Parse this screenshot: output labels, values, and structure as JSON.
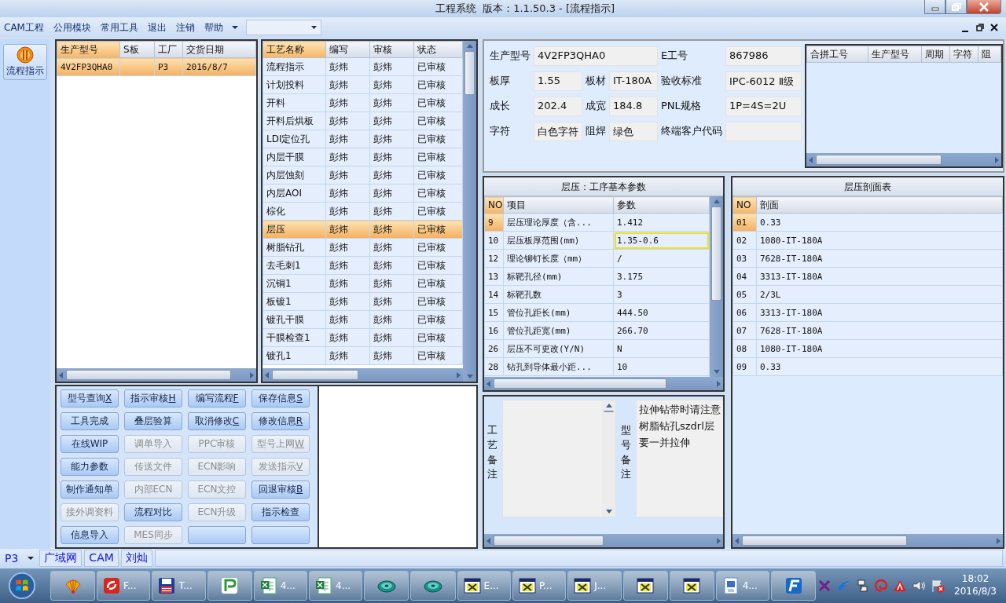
{
  "window": {
    "title": "工程系统  版本：1.1.50.3 - [流程指示]"
  },
  "menu": {
    "items": [
      "CAM工程",
      "公用模块",
      "常用工具",
      "退出",
      "注销",
      "帮助"
    ]
  },
  "sidebar": {
    "items": [
      {
        "label": "流程指示"
      }
    ]
  },
  "orders": {
    "columns": [
      {
        "label": "生产型号",
        "active": true
      },
      {
        "label": "S板",
        "active": false
      },
      {
        "label": "工厂",
        "active": false
      },
      {
        "label": "交货日期",
        "active": false
      }
    ],
    "rows": [
      {
        "model": "4V2FP3QHA0",
        "plant": "P3",
        "delivery": "2016/8/7",
        "selected": true
      }
    ]
  },
  "process": {
    "columns": [
      {
        "label": "工艺名称",
        "active": true
      },
      {
        "label": "编写",
        "active": false
      },
      {
        "label": "审核",
        "active": false
      },
      {
        "label": "状态",
        "active": false
      }
    ],
    "rows": [
      {
        "name": "流程指示",
        "writer": "彭炜",
        "reviewer": "彭炜",
        "status": "已审核",
        "selected": false
      },
      {
        "name": "计划投料",
        "writer": "彭炜",
        "reviewer": "彭炜",
        "status": "已审核",
        "selected": false
      },
      {
        "name": "开料",
        "writer": "彭炜",
        "reviewer": "彭炜",
        "status": "已审核",
        "selected": false
      },
      {
        "name": "开料后烘板",
        "writer": "彭炜",
        "reviewer": "彭炜",
        "status": "已审核",
        "selected": false
      },
      {
        "name": "LDI定位孔",
        "writer": "彭炜",
        "reviewer": "彭炜",
        "status": "已审核",
        "selected": false
      },
      {
        "name": "内层干膜",
        "writer": "彭炜",
        "reviewer": "彭炜",
        "status": "已审核",
        "selected": false
      },
      {
        "name": "内层蚀刻",
        "writer": "彭炜",
        "reviewer": "彭炜",
        "status": "已审核",
        "selected": false
      },
      {
        "name": "内层AOI",
        "writer": "彭炜",
        "reviewer": "彭炜",
        "status": "已审核",
        "selected": false
      },
      {
        "name": "棕化",
        "writer": "彭炜",
        "reviewer": "彭炜",
        "status": "已审核",
        "selected": false
      },
      {
        "name": "层压",
        "writer": "彭炜",
        "reviewer": "彭炜",
        "status": "已审核",
        "selected": true
      },
      {
        "name": "树脂钻孔",
        "writer": "彭炜",
        "reviewer": "彭炜",
        "status": "已审核",
        "selected": false
      },
      {
        "name": "去毛刺1",
        "writer": "彭炜",
        "reviewer": "彭炜",
        "status": "已审核",
        "selected": false
      },
      {
        "name": "沉铜1",
        "writer": "彭炜",
        "reviewer": "彭炜",
        "status": "已审核",
        "selected": false
      },
      {
        "name": "板镀1",
        "writer": "彭炜",
        "reviewer": "彭炜",
        "status": "已审核",
        "selected": false
      },
      {
        "name": "镀孔干膜",
        "writer": "彭炜",
        "reviewer": "彭炜",
        "status": "已审核",
        "selected": false
      },
      {
        "name": "干膜检查1",
        "writer": "彭炜",
        "reviewer": "彭炜",
        "status": "已审核",
        "selected": false
      },
      {
        "name": "镀孔1",
        "writer": "彭炜",
        "reviewer": "彭炜",
        "status": "已审核",
        "selected": false
      }
    ]
  },
  "buttons": [
    {
      "label": "型号查询",
      "hotkey": "X",
      "enabled": true
    },
    {
      "label": "指示审核",
      "hotkey": "H",
      "enabled": true
    },
    {
      "label": "编写流程",
      "hotkey": "F",
      "enabled": true
    },
    {
      "label": "保存信息",
      "hotkey": "S",
      "enabled": true
    },
    {
      "label": "工具完成",
      "enabled": true
    },
    {
      "label": "叠层验算",
      "enabled": true
    },
    {
      "label": "取消修改",
      "hotkey": "C",
      "enabled": true
    },
    {
      "label": "修改信息",
      "hotkey": "R",
      "enabled": true
    },
    {
      "label": "在线WIP",
      "enabled": true
    },
    {
      "label": "调单导入",
      "enabled": false
    },
    {
      "label": "PPC审核",
      "enabled": false
    },
    {
      "label": "型号上网",
      "hotkey": "W",
      "enabled": false
    },
    {
      "label": "能力参数",
      "enabled": true
    },
    {
      "label": "传送文件",
      "enabled": false
    },
    {
      "label": "ECN影响",
      "enabled": false
    },
    {
      "label": "发送指示",
      "hotkey": "V",
      "enabled": false
    },
    {
      "label": "制作通知单",
      "enabled": true
    },
    {
      "label": "内部ECN",
      "enabled": false
    },
    {
      "label": "ECN文控",
      "enabled": false
    },
    {
      "label": "回退审核",
      "hotkey": "B",
      "enabled": true
    },
    {
      "label": "接外调资料",
      "enabled": false
    },
    {
      "label": "流程对比",
      "enabled": true
    },
    {
      "label": "ECN升级",
      "enabled": false
    },
    {
      "label": "指示检查",
      "enabled": true
    },
    {
      "label": "信息导入",
      "enabled": true
    },
    {
      "label": "MES同步",
      "enabled": false
    },
    {
      "enabled": true
    },
    {
      "enabled": true
    }
  ],
  "info": {
    "fields": [
      {
        "label": "生产型号",
        "value": "4V2FP3QHA0"
      },
      {
        "label": "E工号",
        "value": "867986"
      },
      {
        "label": "板厚",
        "value": "1.55"
      },
      {
        "label": "板材",
        "value": "IT-180A"
      },
      {
        "label": "验收标准",
        "value": "IPC-6012 Ⅱ级"
      },
      {
        "label": "成长",
        "value": "202.4"
      },
      {
        "label": "成宽",
        "value": "184.8"
      },
      {
        "label": "PNL规格",
        "value": "1P=4S=2U"
      },
      {
        "label": "字符",
        "value": "白色字符"
      },
      {
        "label": "阻焊",
        "value": "绿色"
      },
      {
        "label": "终端客户代码"
      }
    ]
  },
  "merge_table": {
    "columns": [
      "合拼工号",
      "生产型号",
      "周期",
      "字符",
      "阻"
    ]
  },
  "params": {
    "title": "层压：工序基本参数",
    "columns": [
      "NO",
      "项目",
      "参数"
    ],
    "rows": [
      {
        "no": "9",
        "item": "层压理论厚度（含...",
        "value": "1.412",
        "selected": true,
        "highlighted": false
      },
      {
        "no": "10",
        "item": "层压板厚范围(mm)",
        "value": "1.35-0.6",
        "selected": false,
        "highlighted": true
      },
      {
        "no": "12",
        "item": "理论铆钉长度（mm）",
        "value": "/",
        "selected": false,
        "highlighted": false
      },
      {
        "no": "13",
        "item": "标靶孔径(mm)",
        "value": "3.175",
        "selected": false,
        "highlighted": false
      },
      {
        "no": "14",
        "item": "标靶孔数",
        "value": "3",
        "selected": false,
        "highlighted": false
      },
      {
        "no": "15",
        "item": "管位孔距长(mm)",
        "value": "444.50",
        "selected": false,
        "highlighted": false
      },
      {
        "no": "16",
        "item": "管位孔距宽(mm)",
        "value": "266.70",
        "selected": false,
        "highlighted": false
      },
      {
        "no": "26",
        "item": "层压不可更改(Y/N)",
        "value": "N",
        "selected": false,
        "highlighted": false
      },
      {
        "no": "28",
        "item": "钻孔到导体最小距...",
        "value": "10",
        "selected": false,
        "highlighted": false
      }
    ]
  },
  "laminate": {
    "title": "层压剖面表",
    "columns": [
      "NO",
      "剖面"
    ],
    "rows": [
      {
        "no": "01",
        "layer": "0.33",
        "selected": true
      },
      {
        "no": "02",
        "layer": "1080-IT-180A",
        "selected": false
      },
      {
        "no": "03",
        "layer": "7628-IT-180A",
        "selected": false
      },
      {
        "no": "04",
        "layer": "3313-IT-180A",
        "selected": false
      },
      {
        "no": "05",
        "layer": "2/3L",
        "selected": false
      },
      {
        "no": "06",
        "layer": "3313-IT-180A",
        "selected": false
      },
      {
        "no": "07",
        "layer": "7628-IT-180A",
        "selected": false
      },
      {
        "no": "08",
        "layer": "1080-IT-180A",
        "selected": false
      },
      {
        "no": "09",
        "layer": "0.33",
        "selected": false
      }
    ]
  },
  "notes": {
    "process_label": "工艺备注",
    "model_label": "型号备注",
    "model_lines": [
      "拉伸钻带时请注意",
      "树脂钻孔szdrl层",
      "要一并拉伸"
    ]
  },
  "status_bar": {
    "plant": "P3",
    "cells": [
      "广域网",
      "CAM",
      "刘灿"
    ]
  },
  "taskbar": {
    "items": [
      {
        "kind": "shell"
      },
      {
        "kind": "swirl",
        "label": "F..."
      },
      {
        "kind": "floppy",
        "label": "T..."
      },
      {
        "kind": "tile"
      },
      {
        "kind": "sheet",
        "label": "4..."
      },
      {
        "kind": "sheet",
        "label": "4..."
      },
      {
        "kind": "disc"
      },
      {
        "kind": "disc"
      },
      {
        "kind": "xwin",
        "label": "E..."
      },
      {
        "kind": "xwin",
        "label": "P..."
      },
      {
        "kind": "xwin",
        "label": "J..."
      },
      {
        "kind": "xwin"
      },
      {
        "kind": "xwin"
      },
      {
        "kind": "doc",
        "label": "4..."
      },
      {
        "kind": "tile2"
      }
    ],
    "time": "18:02",
    "date": "2016/8/3"
  }
}
